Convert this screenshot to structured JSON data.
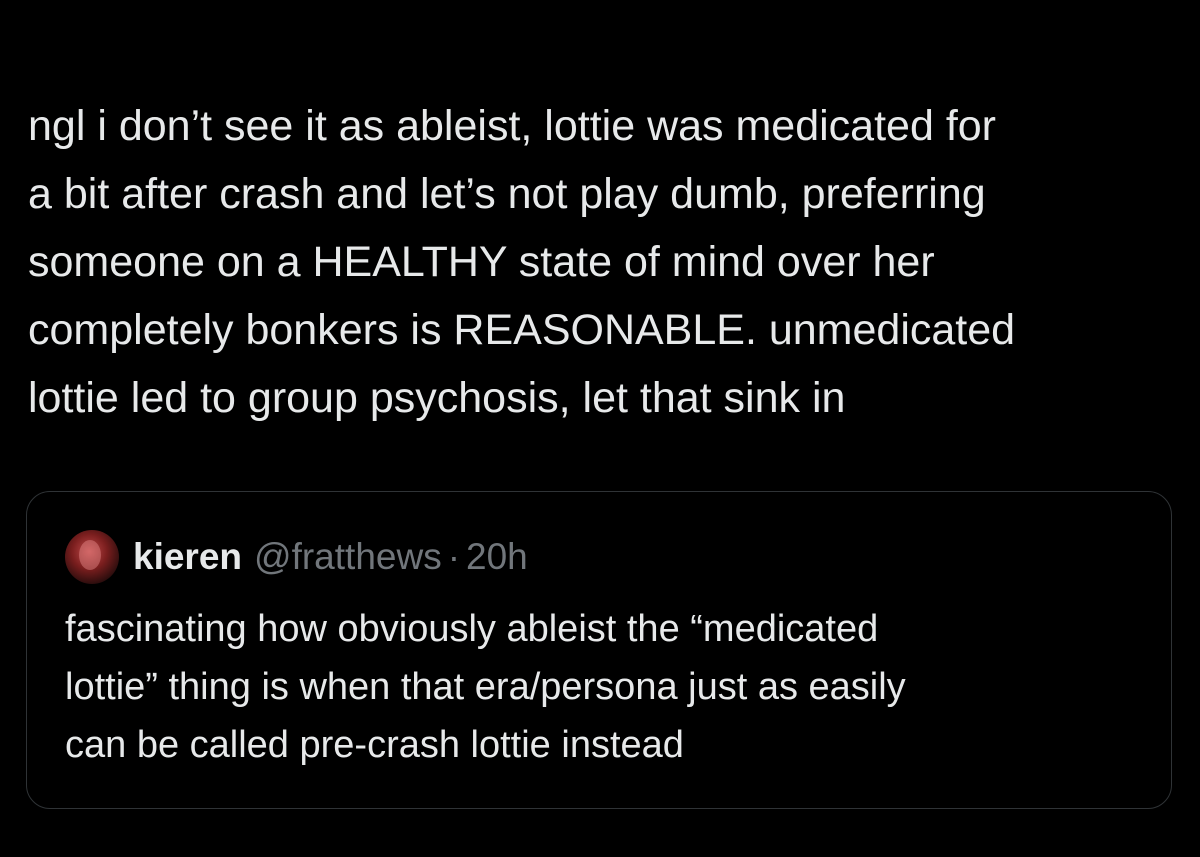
{
  "tweet": {
    "lines": [
      "ngl i don’t see it as ableist, lottie was medicated for",
      "a bit after crash and let’s not play dumb, preferring",
      "someone on a HEALTHY state of mind over her",
      "completely bonkers is REASONABLE. unmedicated",
      "lottie led to group psychosis, let that sink in"
    ]
  },
  "quote": {
    "name": "kieren",
    "handle": "@fratthews",
    "separator": "·",
    "time": "20h",
    "lines": [
      "fascinating how obviously ableist the “medicated",
      "lottie” thing is when that era/persona just as easily",
      "can be called pre-crash lottie instead"
    ]
  },
  "colors": {
    "background": "#000000",
    "text": "#e7e9ea",
    "muted": "#71767b",
    "border": "#2f3336"
  }
}
